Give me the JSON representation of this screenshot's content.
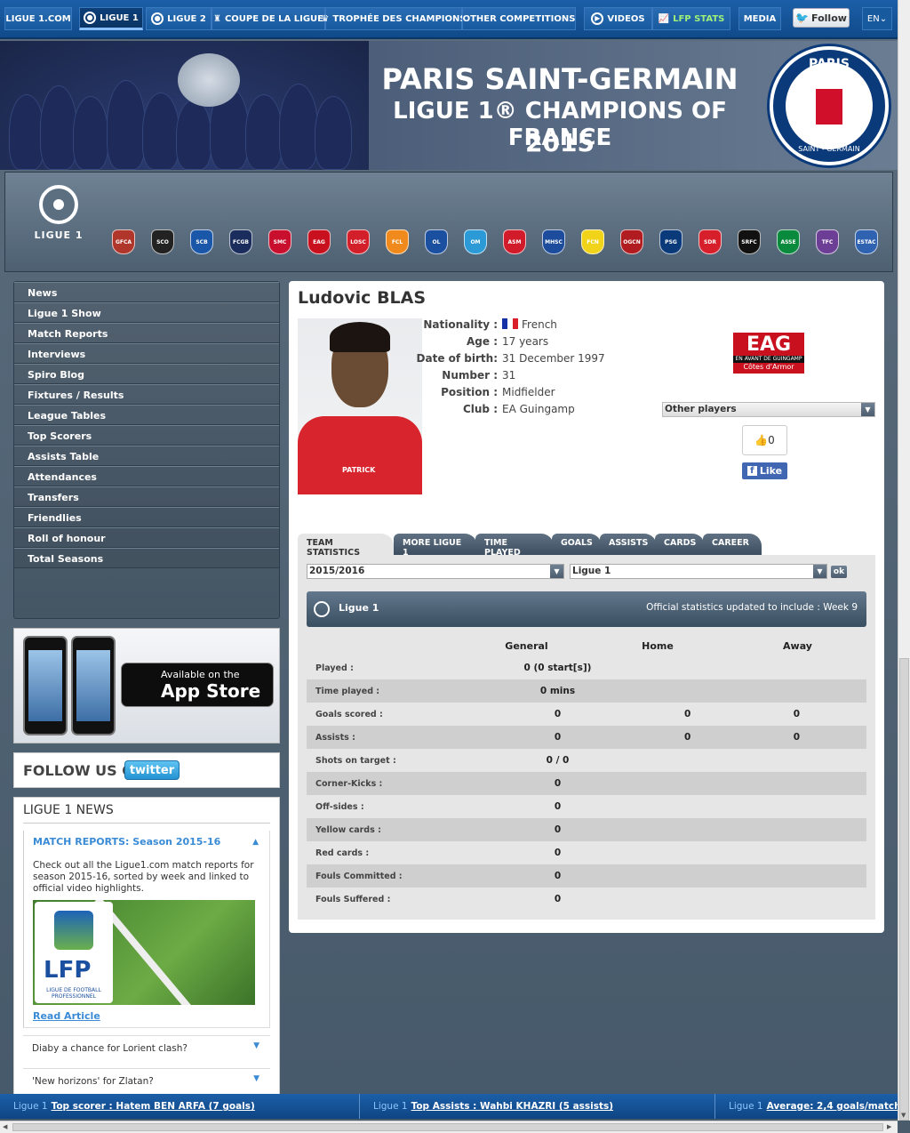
{
  "topnav": {
    "items": [
      {
        "label": "LIGUE 1.COM",
        "icon": ""
      },
      {
        "label": "LIGUE 1",
        "icon": "ball-icon"
      },
      {
        "label": "LIGUE 2",
        "icon": "ball-icon"
      },
      {
        "label": "COUPE DE LA LIGUE",
        "icon": "cup-icon"
      },
      {
        "label": "TROPHÉE DES CHAMPIONS",
        "icon": "trophy-icon"
      },
      {
        "label": "OTHER COMPETITIONS",
        "icon": ""
      },
      {
        "label": "VIDEOS",
        "icon": "play-icon"
      },
      {
        "label": "LFP STATS",
        "icon": "chart-icon"
      },
      {
        "label": "MEDIA",
        "icon": ""
      }
    ],
    "follow_label": "Follow",
    "lang": "EN"
  },
  "banner": {
    "line1": "PARIS SAINT-GERMAIN",
    "line2": "LIGUE 1® CHAMPIONS OF FRANCE",
    "line3": "2015",
    "crest_top": "PARIS",
    "crest_bottom": "SAINT - GERMAIN"
  },
  "league_logo_text": "LIGUE 1",
  "clubs": [
    {
      "abbr": "GFCA",
      "color": "#b0352a"
    },
    {
      "abbr": "SCO",
      "color": "#222"
    },
    {
      "abbr": "SCB",
      "color": "#1b57a8"
    },
    {
      "abbr": "FCGB",
      "color": "#1a2d5c"
    },
    {
      "abbr": "SMC",
      "color": "#c8102e"
    },
    {
      "abbr": "EAG",
      "color": "#c8101e"
    },
    {
      "abbr": "LOSC",
      "color": "#d21f2a"
    },
    {
      "abbr": "FCL",
      "color": "#f08a1c"
    },
    {
      "abbr": "OL",
      "color": "#1b4fa0"
    },
    {
      "abbr": "OM",
      "color": "#2b9ad6"
    },
    {
      "abbr": "ASM",
      "color": "#d11a2a"
    },
    {
      "abbr": "MHSC",
      "color": "#1c4c9b"
    },
    {
      "abbr": "FCN",
      "color": "#f1d31a"
    },
    {
      "abbr": "OGCN",
      "color": "#b01c20"
    },
    {
      "abbr": "PSG",
      "color": "#0b3a7a"
    },
    {
      "abbr": "SDR",
      "color": "#d71e2b"
    },
    {
      "abbr": "SRFC",
      "color": "#111"
    },
    {
      "abbr": "ASSE",
      "color": "#0a8a3c"
    },
    {
      "abbr": "TFC",
      "color": "#6d3e96"
    },
    {
      "abbr": "ESTAC",
      "color": "#2f62b0"
    }
  ],
  "sidebar": {
    "items": [
      "News",
      "Ligue 1 Show",
      "Match Reports",
      "Interviews",
      "Spiro Blog",
      "Fixtures / Results",
      "League Tables",
      "Top Scorers",
      "Assists Table",
      "Attendances",
      "Transfers",
      "Friendlies",
      "Roll of honour",
      "Total Seasons"
    ]
  },
  "appstore": {
    "line1": "Available on the",
    "line2": "App Store"
  },
  "follow": {
    "text": "FOLLOW US ON",
    "twitter": "twitter"
  },
  "news": {
    "heading": "LIGUE 1 NEWS",
    "open_title": "MATCH REPORTS: Season 2015-16",
    "open_body": "Check out all the Ligue1.com match reports for season 2015-16, sorted by week and linked to official video highlights.",
    "lfp_big": "LFP",
    "lfp_small": "LIGUE DE FOOTBALL PROFESSIONNEL",
    "read_more": "Read Article",
    "others": [
      "Diaby a chance for Lorient clash?",
      "'New horizons' for Zlatan?"
    ]
  },
  "player": {
    "name": "Ludovic BLAS",
    "info": [
      {
        "label": "Nationality :",
        "value": "French"
      },
      {
        "label": "Age :",
        "value": "17 years"
      },
      {
        "label": "Date of birth:",
        "value": "31 December 1997"
      },
      {
        "label": "Number :",
        "value": "31"
      },
      {
        "label": "Position :",
        "value": "Midfielder"
      },
      {
        "label": "Club :",
        "value": "EA Guingamp"
      }
    ],
    "shirt_sponsor": "PATRICK",
    "club_logo_abbr": "EAG",
    "club_logo_sub": "EN AVANT DE GUINGAMP",
    "club_logo_region": "Côtes d'Armor",
    "other_players": "Other players",
    "like_count": "0",
    "like_label": "Like"
  },
  "tabs": [
    "TEAM STATISTICS",
    "MORE LIGUE 1",
    "TIME PLAYED",
    "GOALS",
    "ASSISTS",
    "CARDS",
    "CAREER"
  ],
  "filters": {
    "season": "2015/2016",
    "competition": "Ligue 1",
    "ok": "ok"
  },
  "statbar": {
    "left": "Ligue 1",
    "right": "Official statistics updated to include : Week 9"
  },
  "stats": {
    "headers": [
      "",
      "General",
      "Home",
      "Away"
    ],
    "rows": [
      [
        "Played :",
        "0 (0 start[s])",
        "",
        ""
      ],
      [
        "Time played :",
        "0 mins",
        "",
        ""
      ],
      [
        "Goals scored :",
        "0",
        "0",
        "0"
      ],
      [
        "Assists :",
        "0",
        "0",
        "0"
      ],
      [
        "Shots on target :",
        "0 / 0",
        "",
        ""
      ],
      [
        "Corner-Kicks :",
        "0",
        "",
        ""
      ],
      [
        "Off-sides :",
        "0",
        "",
        ""
      ],
      [
        "Yellow cards :",
        "0",
        "",
        ""
      ],
      [
        "Red cards :",
        "0",
        "",
        ""
      ],
      [
        "Fouls Committed :",
        "0",
        "",
        ""
      ],
      [
        "Fouls Suffered :",
        "0",
        "",
        ""
      ]
    ]
  },
  "ticker": [
    {
      "league": "Ligue 1",
      "text": "Top scorer : Hatem BEN ARFA (7 goals)"
    },
    {
      "league": "Ligue 1",
      "text": "Top Assists : Wahbi KHAZRI (5 assists)"
    },
    {
      "league": "Ligue 1",
      "text": "Average: 2,4 goals/match"
    }
  ]
}
